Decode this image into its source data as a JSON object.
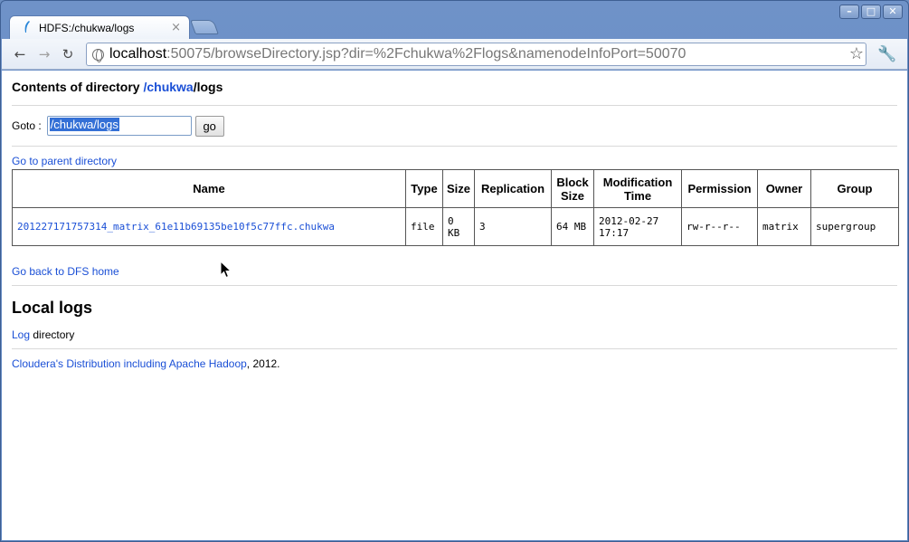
{
  "browser": {
    "tab_title": "HDFS:/chukwa/logs",
    "tab_close": "×",
    "window_buttons": {
      "minimize": "–",
      "maximize": "□",
      "close": "✕"
    },
    "nav": {
      "back": "←",
      "forward": "→",
      "reload": "↻"
    },
    "url_host": "localhost",
    "url_rest": ":50075/browseDirectory.jsp?dir=%2Fchukwa%2Flogs&namenodeInfoPort=50070",
    "star": "☆",
    "wrench": "🔧"
  },
  "page": {
    "heading_prefix": "Contents of directory ",
    "heading_link": "/chukwa",
    "heading_suffix": "/logs",
    "goto_label": "Goto :",
    "goto_value": "/chukwa/logs",
    "go_button": "go",
    "parent_link": "Go to parent directory",
    "table": {
      "headers": [
        "Name",
        "Type",
        "Size",
        "Replication",
        "Block Size",
        "Modification Time",
        "Permission",
        "Owner",
        "Group"
      ],
      "rows": [
        {
          "name": "201227171757314_matrix_61e11b69135be10f5c77ffc.chukwa",
          "type": "file",
          "size": "0 KB",
          "replication": "3",
          "block_size": "64 MB",
          "mtime": "2012-02-27 17:17",
          "permission": "rw-r--r--",
          "owner": "matrix",
          "group": "supergroup"
        }
      ]
    },
    "back_link": "Go back to DFS home",
    "local_logs_heading": "Local logs",
    "log_link": "Log",
    "log_suffix": " directory",
    "footer_link": "Cloudera's Distribution including Apache Hadoop",
    "footer_suffix": ", 2012."
  },
  "colors": {
    "link": "#1a4fd6",
    "selection": "#3470d6"
  }
}
